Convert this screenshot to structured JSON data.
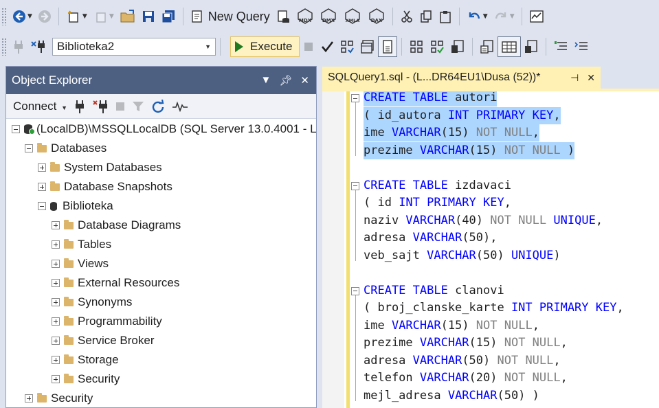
{
  "toolbar1": {
    "new_query_label": "New Query",
    "query_type_buttons": [
      "MDX",
      "DMX",
      "XMLA",
      "DAX"
    ]
  },
  "toolbar2": {
    "database": "Biblioteka2",
    "execute_label": "Execute"
  },
  "object_explorer": {
    "title": "Object Explorer",
    "connect_label": "Connect",
    "tree": [
      {
        "label": "(LocalDB)\\MSSQLLocalDB (SQL Server 13.0.4001 - L",
        "level": 0,
        "expanded": true,
        "icon": "server-icon"
      },
      {
        "label": "Databases",
        "level": 1,
        "expanded": true,
        "icon": "folder-icon"
      },
      {
        "label": "System Databases",
        "level": 2,
        "expanded": false,
        "icon": "folder-icon"
      },
      {
        "label": "Database Snapshots",
        "level": 2,
        "expanded": false,
        "icon": "folder-icon"
      },
      {
        "label": "Biblioteka",
        "level": 2,
        "expanded": true,
        "icon": "database-icon"
      },
      {
        "label": "Database Diagrams",
        "level": 3,
        "expanded": false,
        "icon": "folder-icon"
      },
      {
        "label": "Tables",
        "level": 3,
        "expanded": false,
        "icon": "folder-icon"
      },
      {
        "label": "Views",
        "level": 3,
        "expanded": false,
        "icon": "folder-icon"
      },
      {
        "label": "External Resources",
        "level": 3,
        "expanded": false,
        "icon": "folder-icon"
      },
      {
        "label": "Synonyms",
        "level": 3,
        "expanded": false,
        "icon": "folder-icon"
      },
      {
        "label": "Programmability",
        "level": 3,
        "expanded": false,
        "icon": "folder-icon"
      },
      {
        "label": "Service Broker",
        "level": 3,
        "expanded": false,
        "icon": "folder-icon"
      },
      {
        "label": "Storage",
        "level": 3,
        "expanded": false,
        "icon": "folder-icon"
      },
      {
        "label": "Security",
        "level": 3,
        "expanded": false,
        "icon": "folder-icon"
      },
      {
        "label": "Security",
        "level": 1,
        "expanded": false,
        "icon": "folder-icon"
      }
    ]
  },
  "editor": {
    "tab_title": "SQLQuery1.sql - (L...DR64EU1\\Dusa (52))*",
    "lines": [
      {
        "tokens": [
          [
            "k",
            "CREATE TABLE "
          ],
          [
            "d",
            "autori"
          ]
        ],
        "selected": true
      },
      {
        "tokens": [
          [
            "d",
            "( id_autora "
          ],
          [
            "k",
            "INT PRIMARY KEY"
          ],
          [
            "d",
            ","
          ]
        ],
        "selected": true
      },
      {
        "tokens": [
          [
            "d",
            "ime "
          ],
          [
            "k",
            "VARCHAR"
          ],
          [
            "d",
            "(15) "
          ],
          [
            "n",
            "NOT NULL"
          ],
          [
            "d",
            ","
          ]
        ],
        "selected": true
      },
      {
        "tokens": [
          [
            "d",
            "prezime "
          ],
          [
            "k",
            "VARCHAR"
          ],
          [
            "d",
            "(15) "
          ],
          [
            "n",
            "NOT NULL "
          ],
          [
            "d",
            ")"
          ]
        ],
        "selected": true
      },
      {
        "tokens": [],
        "selected": false
      },
      {
        "tokens": [
          [
            "k",
            "CREATE TABLE "
          ],
          [
            "d",
            "izdavaci"
          ]
        ],
        "selected": false
      },
      {
        "tokens": [
          [
            "d",
            "( id "
          ],
          [
            "k",
            "INT PRIMARY KEY"
          ],
          [
            "d",
            ","
          ]
        ],
        "selected": false
      },
      {
        "tokens": [
          [
            "d",
            "naziv "
          ],
          [
            "k",
            "VARCHAR"
          ],
          [
            "d",
            "(40) "
          ],
          [
            "n",
            "NOT NULL "
          ],
          [
            "k",
            "UNIQUE"
          ],
          [
            "d",
            ","
          ]
        ],
        "selected": false
      },
      {
        "tokens": [
          [
            "d",
            "adresa "
          ],
          [
            "k",
            "VARCHAR"
          ],
          [
            "d",
            "(50),"
          ]
        ],
        "selected": false
      },
      {
        "tokens": [
          [
            "d",
            "veb_sajt "
          ],
          [
            "k",
            "VARCHAR"
          ],
          [
            "d",
            "(50) "
          ],
          [
            "k",
            "UNIQUE"
          ],
          [
            "d",
            ")"
          ]
        ],
        "selected": false
      },
      {
        "tokens": [],
        "selected": false
      },
      {
        "tokens": [
          [
            "k",
            "CREATE TABLE "
          ],
          [
            "d",
            "clanovi"
          ]
        ],
        "selected": false
      },
      {
        "tokens": [
          [
            "d",
            "( broj_clanske_karte "
          ],
          [
            "k",
            "INT PRIMARY KEY"
          ],
          [
            "d",
            ","
          ]
        ],
        "selected": false
      },
      {
        "tokens": [
          [
            "d",
            "ime "
          ],
          [
            "k",
            "VARCHAR"
          ],
          [
            "d",
            "(15) "
          ],
          [
            "n",
            "NOT NULL"
          ],
          [
            "d",
            ","
          ]
        ],
        "selected": false
      },
      {
        "tokens": [
          [
            "d",
            "prezime "
          ],
          [
            "k",
            "VARCHAR"
          ],
          [
            "d",
            "(15) "
          ],
          [
            "n",
            "NOT NULL"
          ],
          [
            "d",
            ","
          ]
        ],
        "selected": false
      },
      {
        "tokens": [
          [
            "d",
            "adresa "
          ],
          [
            "k",
            "VARCHAR"
          ],
          [
            "d",
            "(50) "
          ],
          [
            "n",
            "NOT NULL"
          ],
          [
            "d",
            ","
          ]
        ],
        "selected": false
      },
      {
        "tokens": [
          [
            "d",
            "telefon "
          ],
          [
            "k",
            "VARCHAR"
          ],
          [
            "d",
            "(20) "
          ],
          [
            "n",
            "NOT NULL"
          ],
          [
            "d",
            ","
          ]
        ],
        "selected": false
      },
      {
        "tokens": [
          [
            "d",
            "mejl_adresa "
          ],
          [
            "k",
            "VARCHAR"
          ],
          [
            "d",
            "(50) )"
          ]
        ],
        "selected": false
      }
    ]
  },
  "colors": {
    "panel_header": "#4d6082",
    "editor_tab": "#fff1b3",
    "selection": "#add6ff",
    "keyword": "#0000ff",
    "null_keyword": "#808080",
    "execute_play": "#1f7a1f"
  }
}
